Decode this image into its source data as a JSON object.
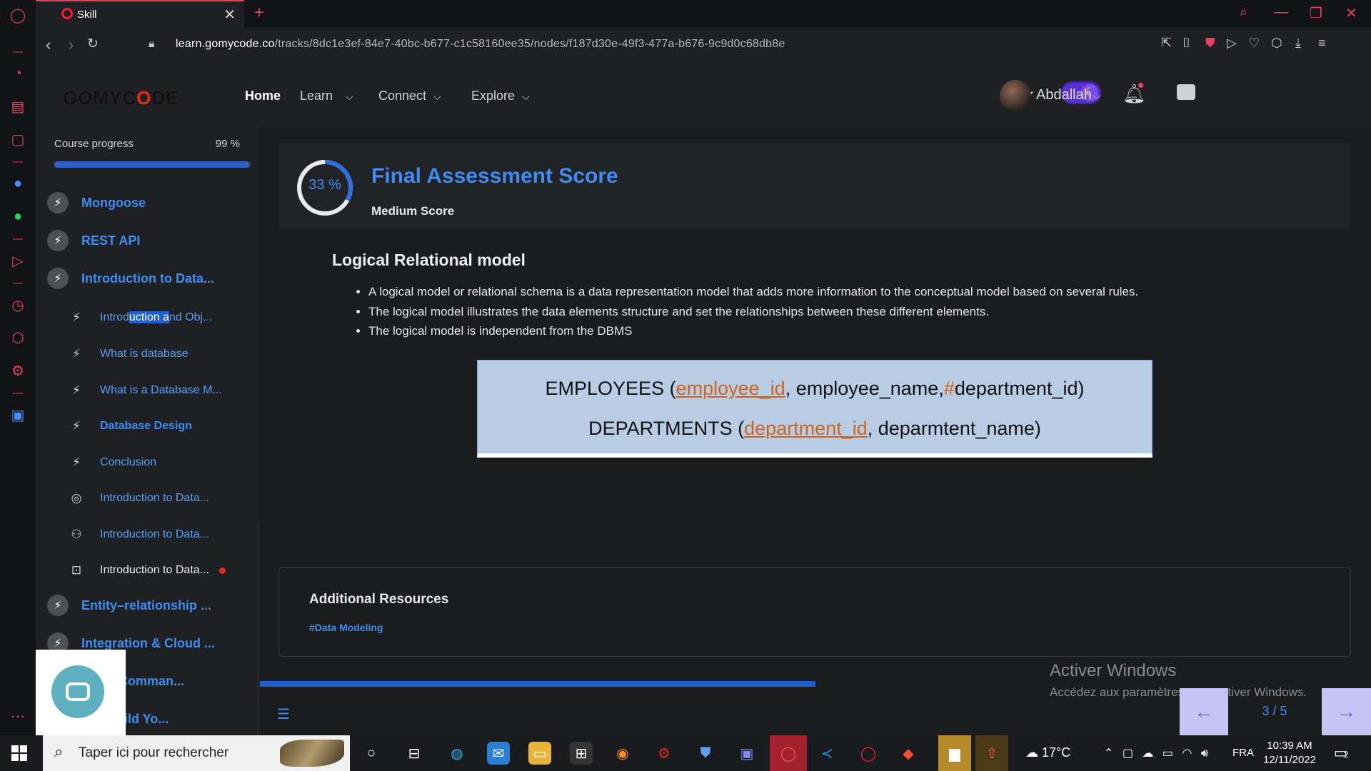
{
  "browser": {
    "tab_title": "Skill",
    "url_domain": "learn.gomycode.co",
    "url_path": "/tracks/8dc1e3ef-84e7-40bc-b677-c1c58160ee35/nodes/f187d30e-49f3-477a-b676-9c9d0c68db8e",
    "new_tab": "+",
    "close_tab": "✕"
  },
  "header": {
    "brand_pre": "GOMYC",
    "brand_o": "O",
    "brand_post": "DE",
    "nav": {
      "home": "Home",
      "learn": "Learn",
      "connect": "Connect",
      "explore": "Explore"
    },
    "username": "Abdallah"
  },
  "sidebar": {
    "progress_label": "Course progress",
    "progress_value": "99 %",
    "progress_fraction": 0.99,
    "modules": [
      {
        "label": "Mongoose"
      },
      {
        "label": "REST API"
      },
      {
        "label": "Introduction to Data..."
      }
    ],
    "lessons": [
      {
        "label_a": "Introd",
        "label_sel": "uction a",
        "label_b": "nd Obj...",
        "icon": "bolt-icon"
      },
      {
        "label": "What is database",
        "icon": "bolt-icon"
      },
      {
        "label": "What is a Database M...",
        "icon": "bolt-icon"
      },
      {
        "label": "Database Design",
        "icon": "bolt-icon"
      },
      {
        "label": "Conclusion",
        "icon": "bolt-icon"
      },
      {
        "label": "Introduction to Data...",
        "icon": "target-icon"
      },
      {
        "label": "Introduction to Data...",
        "icon": "people-icon"
      },
      {
        "label": "Introduction to Data...",
        "icon": "board-icon"
      }
    ],
    "modules_after": [
      {
        "label": "Entity–relationship ..."
      },
      {
        "label": "Integration & Cloud ..."
      },
      {
        "label": "Flow (Comman..."
      },
      {
        "label": "se : Build Yo..."
      }
    ]
  },
  "score": {
    "percent_text": "33 %",
    "percent_value": 33,
    "title": "Final Assessment Score",
    "subtitle": "Medium Score"
  },
  "lesson": {
    "title": "Logical Relational model",
    "bullets": [
      "A logical model or relational schema is a data representation model that adds more information to the conceptual model based on several rules.",
      "The logical model illustrates the data elements structure and set the relationships between these different elements.",
      "The logical model is independent from the DBMS"
    ],
    "diagram": {
      "row1_pre": "EMPLOYEES (",
      "row1_pk": "employee_id",
      "row1_mid": ", employee_name,",
      "row1_hash": "#",
      "row1_post": "department_id)",
      "row2_pre": "DEPARTMENTS (",
      "row2_pk": "department_id",
      "row2_post": ", deparmtent_name)"
    }
  },
  "resources": {
    "title": "Additional Resources",
    "tag": "#Data Modeling"
  },
  "pager": {
    "text": "3 / 5",
    "prev": "←",
    "next": "→",
    "lesson_progress_fraction": 0.5
  },
  "watermark": {
    "line1": "Activer Windows",
    "line2": "Accédez aux paramètres pour activer Windows."
  },
  "taskbar": {
    "search_placeholder": "Taper ici pour rechercher",
    "weather": "17°C",
    "lang": "FRA",
    "time": "10:39 AM",
    "date": "12/11/2022",
    "notif_count": "2"
  },
  "colors": {
    "accent": "#3f8cf0",
    "opera_red": "#e8415b",
    "diagram_bg": "#b8cce4",
    "key_orange": "#d0641c"
  }
}
